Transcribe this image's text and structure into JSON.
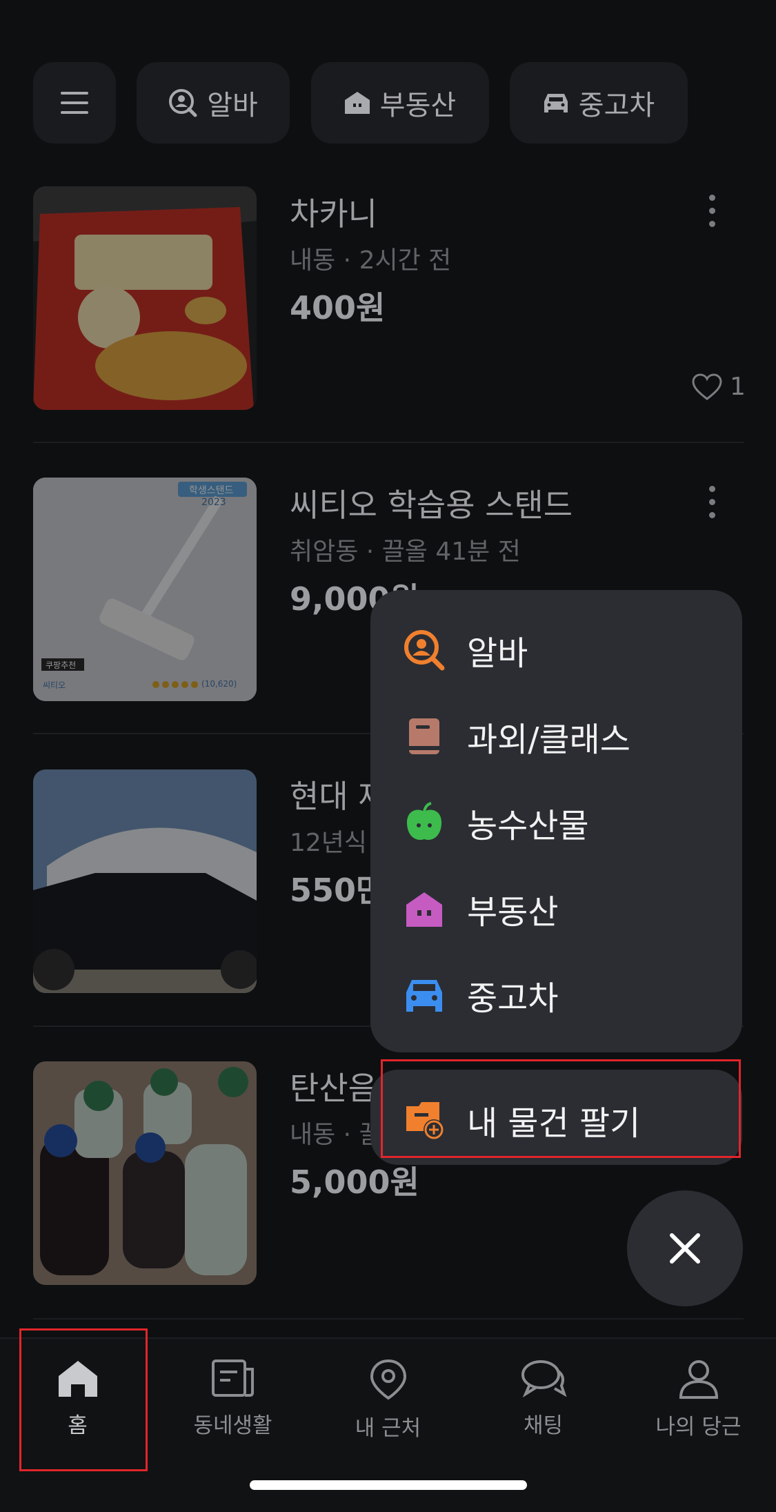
{
  "top_chips": {
    "alba": "알바",
    "realestate": "부동산",
    "usedcar": "중고차"
  },
  "listings": [
    {
      "title": "차카니",
      "meta": "내동 · 2시간 전",
      "price": "400원",
      "likes": "1"
    },
    {
      "title": "씨티오 학습용 스탠드",
      "meta": "취암동 · 끌올 41분 전",
      "price": "9,000원"
    },
    {
      "title": "현대 제",
      "meta": "12년식",
      "price": "550만"
    },
    {
      "title": "탄산음",
      "meta": "내동 · 끌",
      "price": "5,000원"
    }
  ],
  "thumb2_text": {
    "badge": "학생스탠드",
    "year": "2023",
    "coupang": "쿠팡추천",
    "brand": "씨티오",
    "reviews": "(10,620)"
  },
  "write_menu": {
    "items": [
      {
        "label": "알바",
        "icon": "alba-search-icon",
        "color": "#f0802e"
      },
      {
        "label": "과외/클래스",
        "icon": "book-icon",
        "color": "#b77a6a"
      },
      {
        "label": "농수산물",
        "icon": "apple-icon",
        "color": "#3dbb4c"
      },
      {
        "label": "부동산",
        "icon": "house-icon",
        "color": "#c65bc2"
      },
      {
        "label": "중고차",
        "icon": "car-icon",
        "color": "#3b8ef0"
      }
    ],
    "sell_label": "내 물건 팔기",
    "sell_icon_color": "#f0802e"
  },
  "bottom_nav": {
    "home": "홈",
    "community": "동네생활",
    "nearby": "내 근처",
    "chat": "채팅",
    "my": "나의 당근"
  },
  "colors": {
    "highlight": "#e0262b",
    "menu_bg": "#2b2d33"
  }
}
